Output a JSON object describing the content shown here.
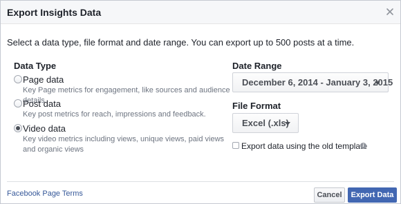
{
  "dialog": {
    "title": "Export Insights Data",
    "close_icon": "close-icon",
    "intro": "Select a data type, file format and date range. You can export up to 500 posts at a time."
  },
  "data_type": {
    "heading": "Data Type",
    "selected": "Video data",
    "options": [
      {
        "label": "Page data",
        "desc": "Key Page metrics for engagement, like sources and audience details.",
        "checked": false
      },
      {
        "label": "Post data",
        "desc": "Key post metrics for reach, impressions and feedback.",
        "checked": false
      },
      {
        "label": "Video data",
        "desc": "Key video metrics including views, unique views, paid views and organic views",
        "checked": true
      }
    ]
  },
  "date_range": {
    "heading": "Date Range",
    "value": "December 6, 2014 - January 3, 2015"
  },
  "file_format": {
    "heading": "File Format",
    "value": "Excel (.xls)"
  },
  "old_template": {
    "label": "Export data using the old template",
    "checked": false,
    "info_icon": "info-icon"
  },
  "footer": {
    "terms_link": "Facebook Page Terms",
    "cancel_label": "Cancel",
    "export_label": "Export Data"
  },
  "colors": {
    "primary": "#4267b2",
    "link": "#365899",
    "header_bg": "#f6f7f9"
  }
}
